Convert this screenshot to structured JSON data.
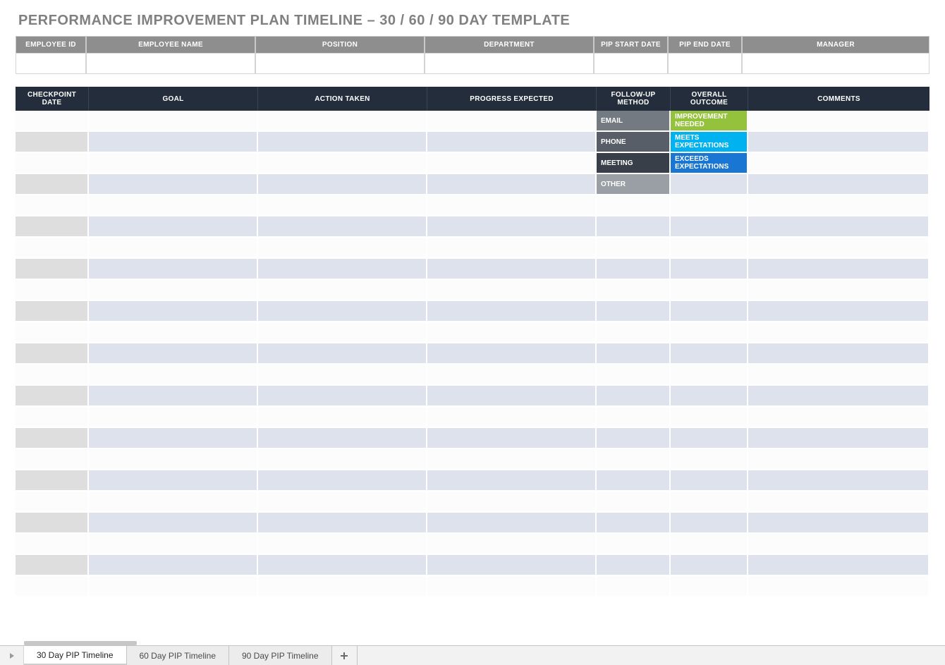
{
  "title": "PERFORMANCE IMPROVEMENT PLAN TIMELINE  –  30 / 60 / 90 DAY TEMPLATE",
  "info_headers": {
    "emp_id": "EMPLOYEE ID",
    "emp_name": "EMPLOYEE NAME",
    "position": "POSITION",
    "department": "DEPARTMENT",
    "pip_start": "PIP START DATE",
    "pip_end": "PIP END DATE",
    "manager": "MANAGER"
  },
  "grid_headers": {
    "checkpoint": "CHECKPOINT DATE",
    "goal": "GOAL",
    "action": "ACTION TAKEN",
    "progress": "PROGRESS EXPECTED",
    "followup": "FOLLOW-UP METHOD",
    "outcome": "OVERALL OUTCOME",
    "comments": "COMMENTS"
  },
  "followup_legend": {
    "email": "EMAIL",
    "phone": "PHONE",
    "meeting": "MEETING",
    "other": "OTHER"
  },
  "outcome_legend": {
    "improvement": "IMPROVEMENT NEEDED",
    "meets": "MEETS EXPECTATIONS",
    "exceeds": "EXCEEDS EXPECTATIONS"
  },
  "tabs": {
    "t30": "30 Day PIP Timeline",
    "t60": "60 Day PIP Timeline",
    "t90": "90 Day PIP Timeline"
  },
  "grid_row_count": 23,
  "colors": {
    "title": "#808080",
    "info_header_bg": "#8e8e8e",
    "grid_header_bg": "#232d3b",
    "zebra_even": "#dde2ed",
    "zebra_odd": "#fcfcfc",
    "first_col_even": "#dedede",
    "followup_email": "#747a82",
    "followup_phone": "#575e68",
    "followup_meeting": "#383f49",
    "followup_other": "#9a9ea5",
    "outcome_improvement": "#94c23c",
    "outcome_meets": "#00b2ef",
    "outcome_exceeds": "#1976d2"
  }
}
